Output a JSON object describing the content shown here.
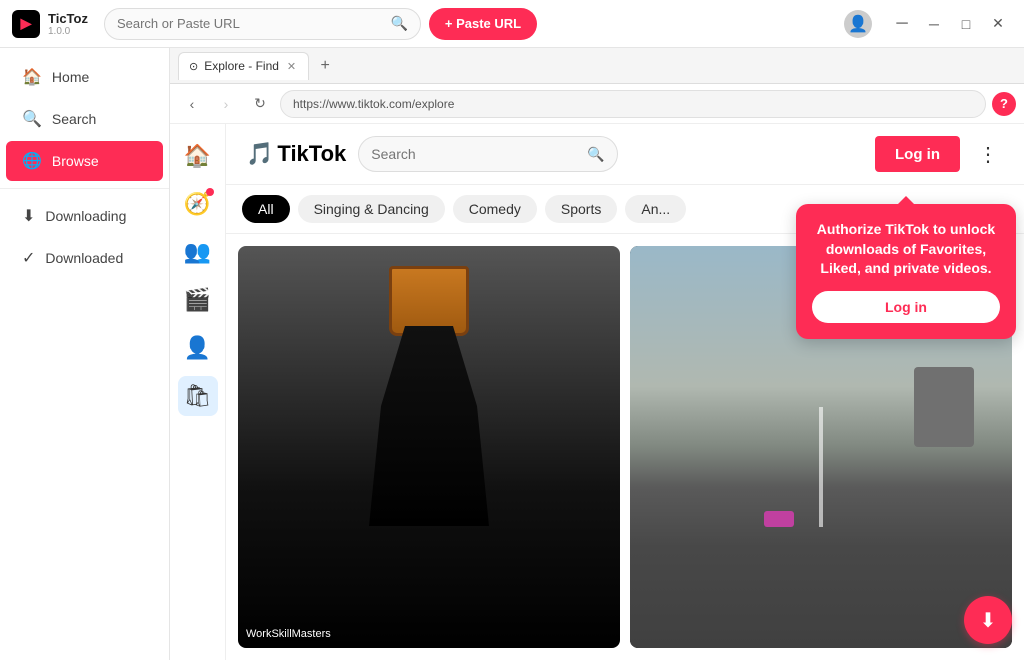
{
  "titlebar": {
    "app_logo": "▶",
    "app_name": "TicToz",
    "app_version": "1.0.0",
    "search_placeholder": "Search or Paste URL",
    "paste_btn_label": "+ Paste URL",
    "win_minimize": "─",
    "win_maximize": "□",
    "win_close": "✕"
  },
  "sidebar": {
    "items": [
      {
        "id": "home",
        "label": "Home",
        "icon": "🏠"
      },
      {
        "id": "search",
        "label": "Search",
        "icon": "🔍"
      },
      {
        "id": "browse",
        "label": "Browse",
        "icon": "🌐",
        "active": true
      }
    ],
    "bottom_items": [
      {
        "id": "downloading",
        "label": "Downloading",
        "icon": "⬇"
      },
      {
        "id": "downloaded",
        "label": "Downloaded",
        "icon": "✓"
      }
    ]
  },
  "browser": {
    "tab_label": "Explore - Find",
    "tab_favicon": "⊙",
    "url": "https://www.tiktok.com/explore",
    "new_tab_label": "+"
  },
  "tiktok": {
    "logo_text": "TikTok",
    "search_placeholder": "Search",
    "login_btn_label": "Log in",
    "categories": [
      {
        "id": "all",
        "label": "All",
        "active": true
      },
      {
        "id": "singing",
        "label": "Singing & Dancing",
        "active": false
      },
      {
        "id": "comedy",
        "label": "Comedy",
        "active": false
      },
      {
        "id": "sports",
        "label": "Sports",
        "active": false
      },
      {
        "id": "anime",
        "label": "An...",
        "active": false
      }
    ],
    "sidenav_icons": [
      "🏠",
      "🧭",
      "👥",
      "🎬",
      "👤",
      "🏪"
    ],
    "video1_caption": "WorkSkillMasters",
    "auth_popup": {
      "text": "Authorize TikTok to unlock downloads of Favorites, Liked, and private videos.",
      "btn_label": "Log in"
    },
    "download_icon": "⬇"
  }
}
